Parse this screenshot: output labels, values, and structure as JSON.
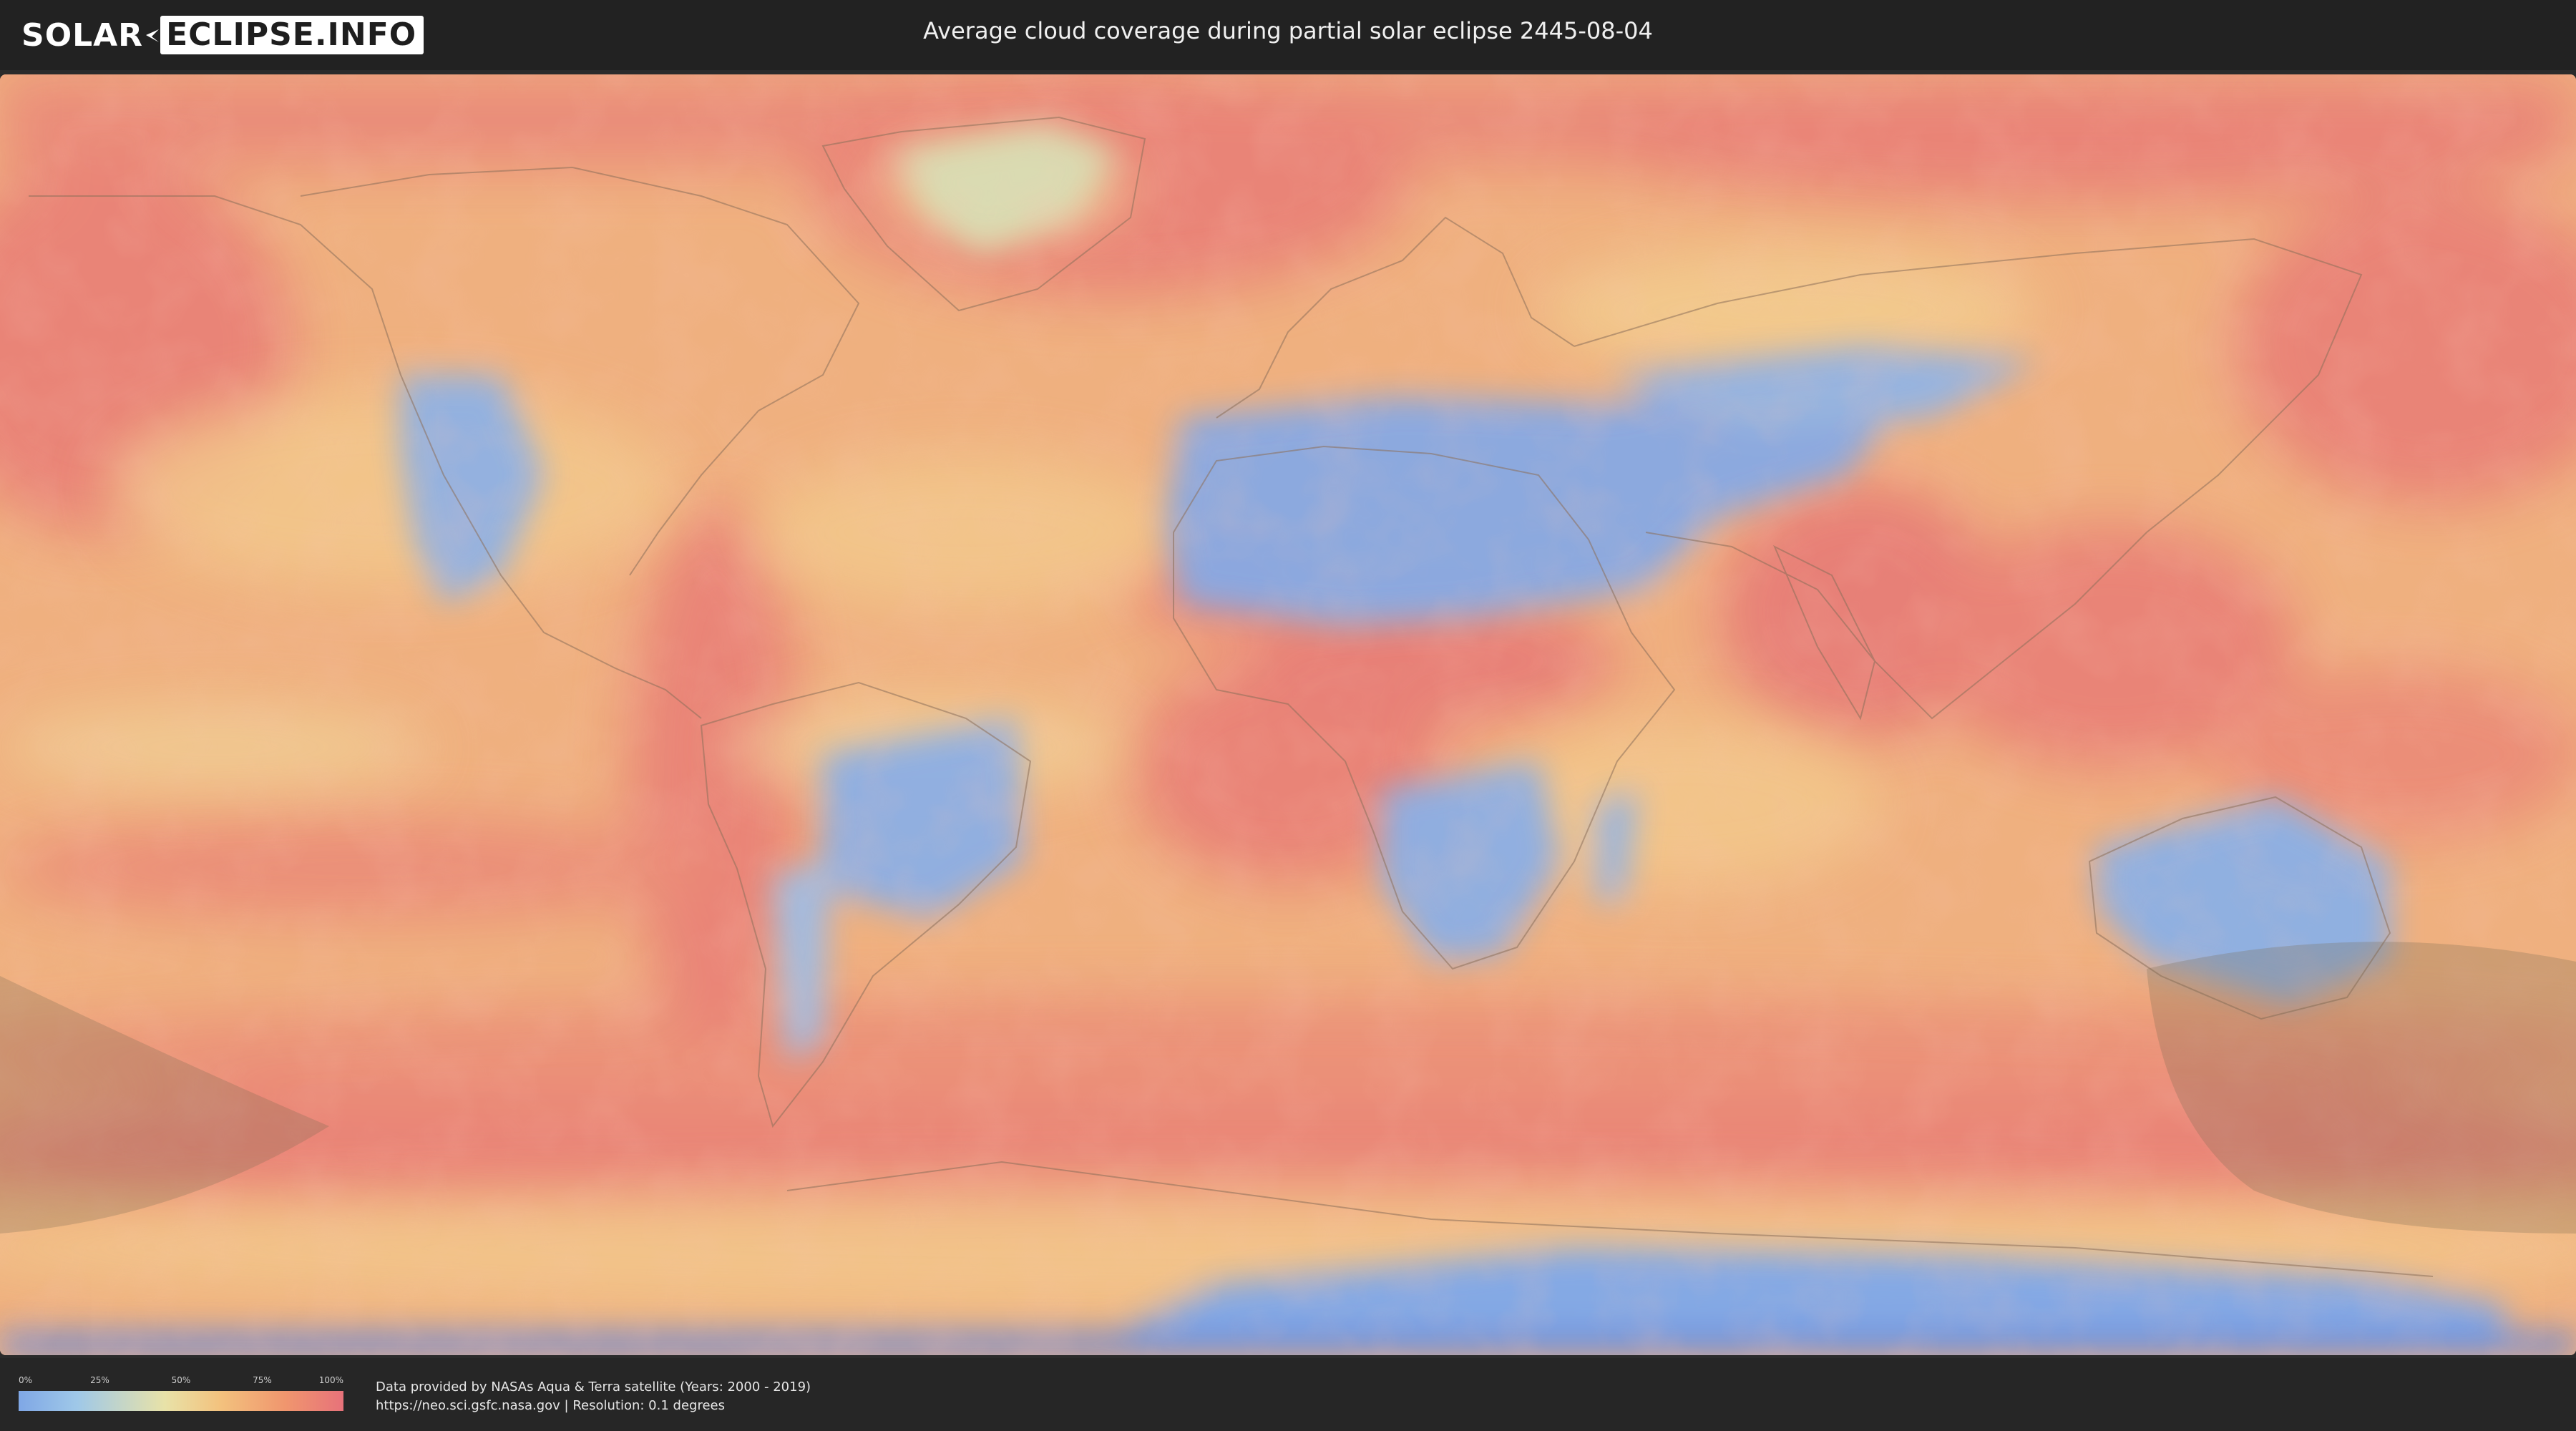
{
  "header": {
    "logo_left": "SOLAR",
    "logo_right": "ECLIPSE.INFO",
    "title": "Average cloud coverage during partial solar eclipse 2445-08-04"
  },
  "legend": {
    "ticks": [
      "0%",
      "25%",
      "50%",
      "75%",
      "100%"
    ],
    "colors": [
      "#7fa7e6",
      "#e8e2a8",
      "#e7727a"
    ]
  },
  "credits": {
    "line1": "Data provided by NASAs Aqua & Terra satellite (Years: 2000 - 2019)",
    "line2": "https://neo.sci.gsfc.nasa.gov | Resolution: 0.1 degrees"
  },
  "map": {
    "projection": "equirectangular",
    "colors": {
      "ocean_cloudy": "#e9877a",
      "mid": "#f2c188",
      "clear": "#8fb1e4",
      "eclipse_shadow": "#7a6a52"
    }
  }
}
